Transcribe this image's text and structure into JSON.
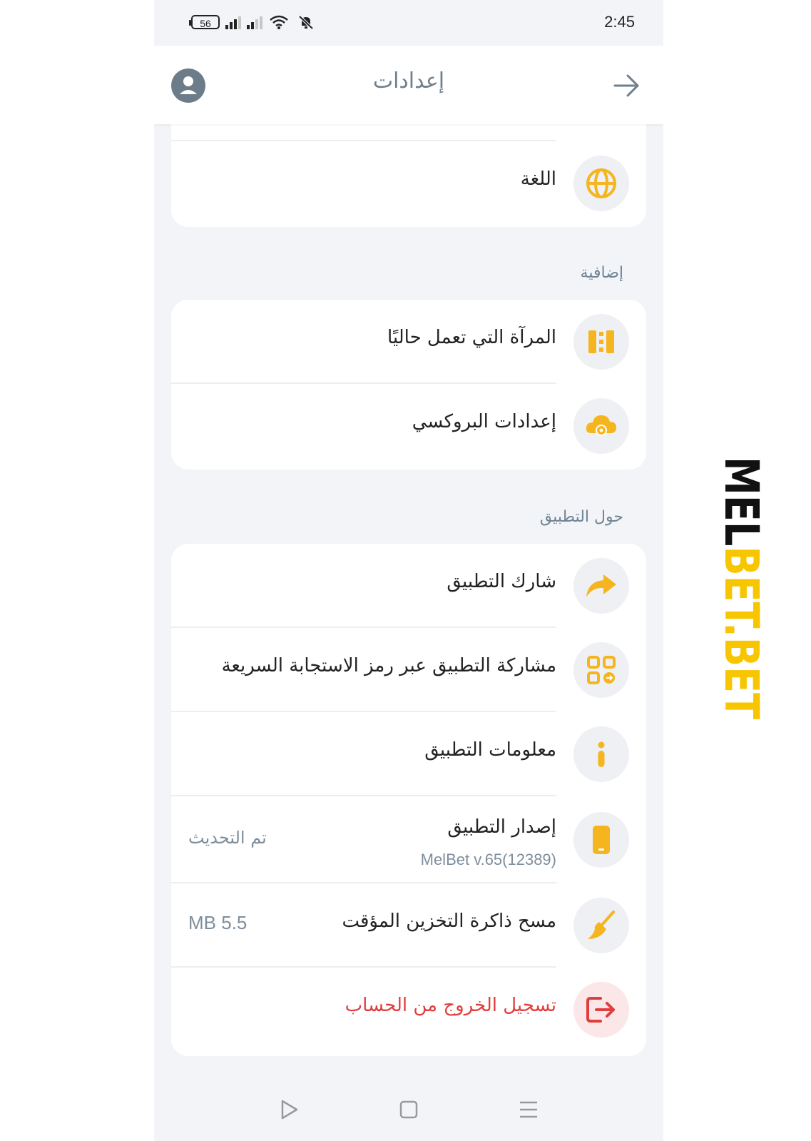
{
  "status_bar": {
    "time": "2:45",
    "battery": "56"
  },
  "header": {
    "title": "إعدادات"
  },
  "language": {
    "label": "اللغة"
  },
  "sections": {
    "extra": "إضافية",
    "about": "حول التطبيق"
  },
  "extra_items": [
    {
      "label": "المرآة التي تعمل حاليًا",
      "icon": "mirror-icon"
    },
    {
      "label": "إعدادات البروكسي",
      "icon": "cloud-gear-icon"
    }
  ],
  "about_items": {
    "share": {
      "label": "شارك التطبيق",
      "icon": "share-icon"
    },
    "share_qr": {
      "label": "مشاركة التطبيق عبر رمز الاستجابة السريعة",
      "icon": "qr-code-icon"
    },
    "info": {
      "label": "معلومات التطبيق",
      "icon": "info-icon"
    },
    "version": {
      "label": "إصدار التطبيق",
      "sublabel": "MelBet v.65(12389)",
      "value": "تم التحديث",
      "icon": "phone-icon"
    },
    "cache": {
      "label": "مسح ذاكرة التخزين المؤقت",
      "value": "5.5 MB",
      "icon": "broom-icon"
    },
    "logout": {
      "label": "تسجيل الخروج من الحساب",
      "icon": "logout-icon"
    }
  },
  "watermark": "MELBET.BET",
  "colors": {
    "accent": "#f4b51f",
    "danger": "#e03e3e",
    "background": "#f2f4f8",
    "muted": "#7f8e9c"
  }
}
